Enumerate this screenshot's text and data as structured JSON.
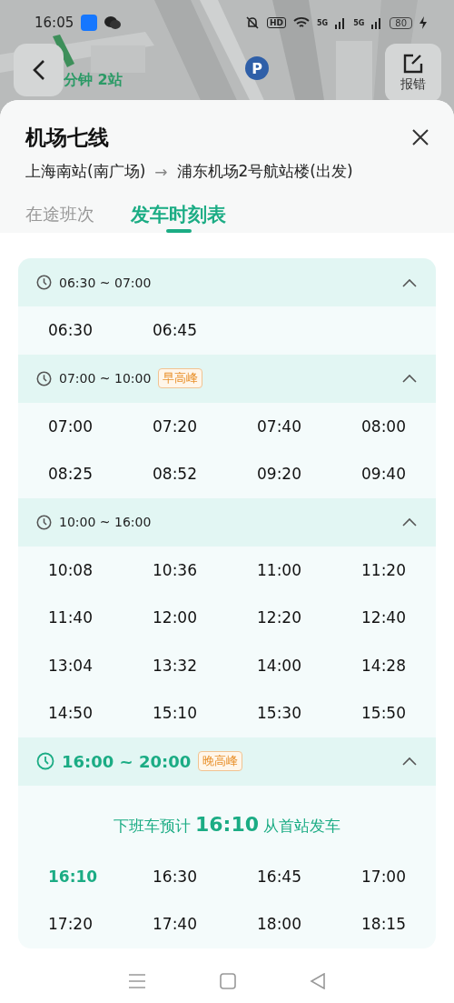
{
  "status_bar": {
    "time": "16:05",
    "network": [
      "5G",
      "5G"
    ],
    "hd": "HD",
    "battery": "80"
  },
  "map": {
    "marker": "P",
    "route_hint": "分钟 2站",
    "report_label": "报错"
  },
  "sheet": {
    "title": "机场七线",
    "from": "上海南站(南广场)",
    "arrow": "→",
    "to": "浦东机场2号航站楼(出发)",
    "tabs": [
      {
        "label": "在途班次",
        "selected": false
      },
      {
        "label": "发车时刻表",
        "selected": true
      }
    ]
  },
  "sections": [
    {
      "range": "06:30 ~ 07:00",
      "current": false,
      "expanded": true,
      "times": [
        {
          "time": "06:30",
          "highlighted": false
        },
        {
          "time": "06:45",
          "highlighted": false
        }
      ]
    },
    {
      "range": "07:00 ~ 10:00",
      "tag": "早高峰",
      "current": false,
      "expanded": true,
      "times": [
        {
          "time": "07:00",
          "highlighted": false
        },
        {
          "time": "07:20",
          "highlighted": false
        },
        {
          "time": "07:40",
          "highlighted": false
        },
        {
          "time": "08:00",
          "highlighted": false
        },
        {
          "time": "08:25",
          "highlighted": false
        },
        {
          "time": "08:52",
          "highlighted": false
        },
        {
          "time": "09:20",
          "highlighted": false
        },
        {
          "time": "09:40",
          "highlighted": false
        }
      ]
    },
    {
      "range": "10:00 ~ 16:00",
      "current": false,
      "expanded": true,
      "times": [
        {
          "time": "10:08",
          "highlighted": false
        },
        {
          "time": "10:36",
          "highlighted": false
        },
        {
          "time": "11:00",
          "highlighted": false
        },
        {
          "time": "11:20",
          "highlighted": false
        },
        {
          "time": "11:40",
          "highlighted": false
        },
        {
          "time": "12:00",
          "highlighted": false
        },
        {
          "time": "12:20",
          "highlighted": false
        },
        {
          "time": "12:40",
          "highlighted": false
        },
        {
          "time": "13:04",
          "highlighted": false
        },
        {
          "time": "13:32",
          "highlighted": false
        },
        {
          "time": "14:00",
          "highlighted": false
        },
        {
          "time": "14:28",
          "highlighted": false
        },
        {
          "time": "14:50",
          "highlighted": false
        },
        {
          "time": "15:10",
          "highlighted": false
        },
        {
          "time": "15:30",
          "highlighted": false
        },
        {
          "time": "15:50",
          "highlighted": false
        }
      ]
    },
    {
      "range": "16:00 ~ 20:00",
      "tag": "晚高峰",
      "current": true,
      "expanded": true,
      "notice": "下班车预计 **16:10** 从首站发车",
      "times": [
        {
          "time": "16:10",
          "highlighted": true
        },
        {
          "time": "16:30",
          "highlighted": false
        },
        {
          "time": "16:45",
          "highlighted": false
        },
        {
          "time": "17:00",
          "highlighted": false
        },
        {
          "time": "17:20",
          "highlighted": false
        },
        {
          "time": "17:40",
          "highlighted": false
        },
        {
          "time": "18:00",
          "highlighted": false
        },
        {
          "time": "18:15",
          "highlighted": false
        }
      ]
    }
  ]
}
